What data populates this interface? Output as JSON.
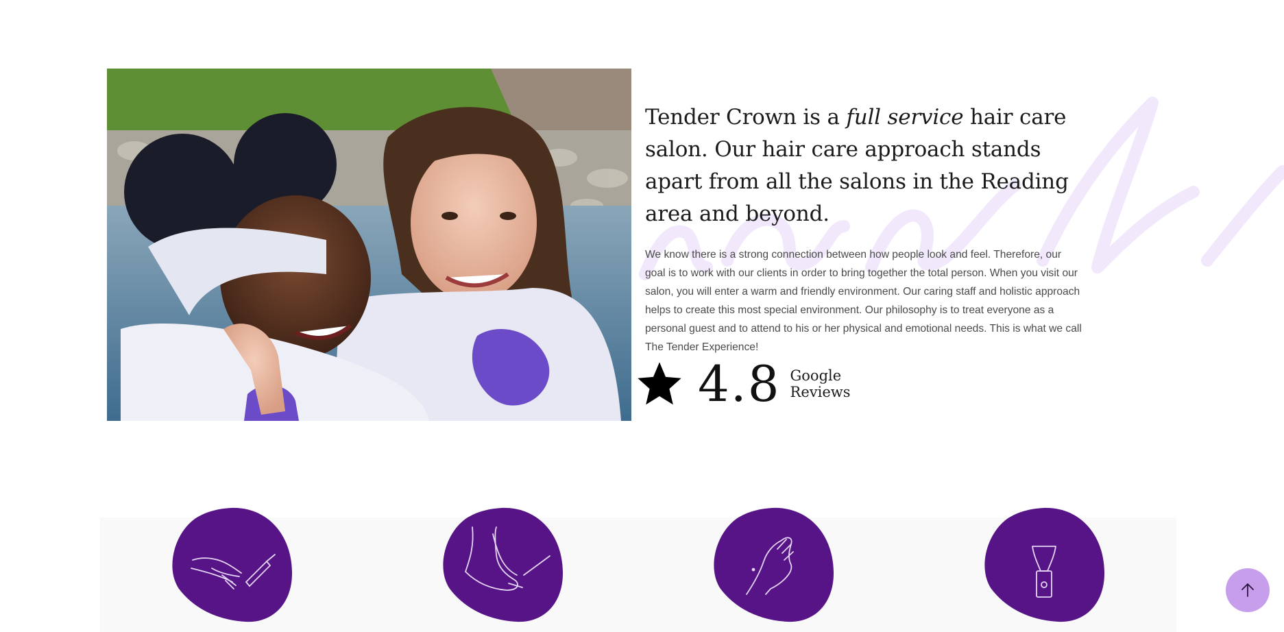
{
  "intro": {
    "heading_part1": "Tender Crown is a ",
    "heading_emphasis": "full service",
    "heading_part2": " hair care salon. Our hair care approach stands apart from all the salons in the Reading area and beyond.",
    "body": "We know there is a strong connection between how people look and feel. Therefore, our goal is to work with our clients in order to bring together the total person. When you visit our salon, you will enter a warm and friendly environment. Our caring staff and holistic approach helps to create this most special environment. Our philosophy is to treat everyone as a personal guest and to attend to his or her physical and emotional needs. This is what we call The Tender Experience!"
  },
  "rating": {
    "icon": "star-icon",
    "score": "4.8",
    "label_line1": "Google",
    "label_line2": "Reviews"
  },
  "services": [
    {
      "icon": "manicure-icon"
    },
    {
      "icon": "pedicure-icon"
    },
    {
      "icon": "nail-hand-icon"
    },
    {
      "icon": "product-bottle-icon"
    }
  ],
  "back_to_top": {
    "icon": "arrow-up-icon"
  },
  "colors": {
    "accent_purple": "#561487",
    "back_to_top_bg": "#c79eec",
    "band_bg": "#f9f9f9",
    "script_watermark": "#f1e8fb"
  }
}
